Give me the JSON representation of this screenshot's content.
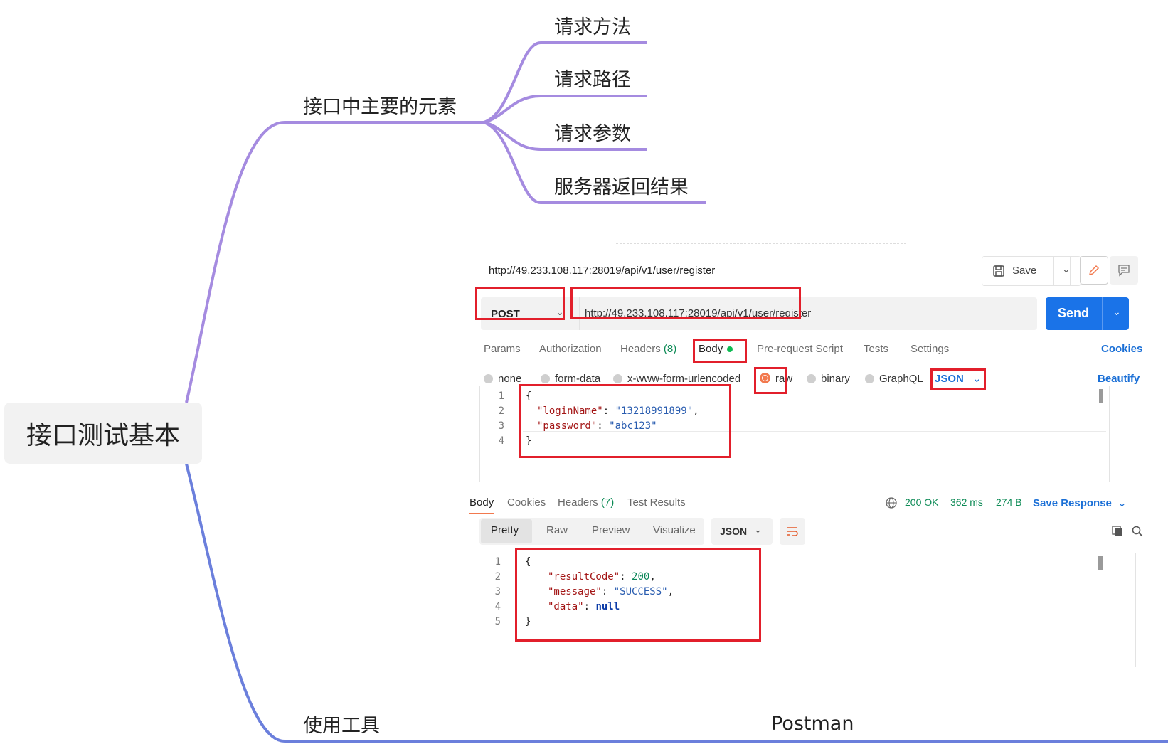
{
  "mindmap": {
    "root": "接口测试基本",
    "branch_elements": "接口中主要的元素",
    "leaves": [
      "请求方法",
      "请求路径",
      "请求参数",
      "服务器返回结果"
    ],
    "branch_tools": "使用工具",
    "tool_name": "Postman",
    "colors": {
      "upper_branch": "#a58be0",
      "lower_branch": "#6b7fdc",
      "highlight_box": "#e21f2b"
    }
  },
  "postman": {
    "request_title": "http://49.233.108.117:28019/api/v1/user/register",
    "save_label": "Save",
    "method": "POST",
    "url": "http://49.233.108.117:28019/api/v1/user/register",
    "send_label": "Send",
    "request_tabs": {
      "params": "Params",
      "authorization": "Authorization",
      "headers": "Headers",
      "headers_count": "(8)",
      "body": "Body",
      "pre_request": "Pre-request Script",
      "tests": "Tests",
      "settings": "Settings",
      "cookies": "Cookies"
    },
    "body_types": {
      "none": "none",
      "form_data": "form-data",
      "urlencoded": "x-www-form-urlencoded",
      "raw": "raw",
      "binary": "binary",
      "graphql": "GraphQL",
      "format": "JSON",
      "beautify": "Beautify"
    },
    "request_body": {
      "line_numbers": [
        "1",
        "2",
        "3",
        "4"
      ],
      "open": "{",
      "close": "}",
      "login_key": "\"loginName\"",
      "login_value": "\"13218991899\"",
      "password_key": "\"password\"",
      "password_value": "\"abc123\""
    },
    "response_tabs": {
      "body": "Body",
      "cookies": "Cookies",
      "headers": "Headers",
      "headers_count": "(7)",
      "test_results": "Test Results"
    },
    "response_status": {
      "code": "200 OK",
      "time": "362 ms",
      "size": "274 B",
      "save_response": "Save Response"
    },
    "view_modes": {
      "pretty": "Pretty",
      "raw": "Raw",
      "preview": "Preview",
      "visualize": "Visualize",
      "format": "JSON"
    },
    "response_body": {
      "line_numbers": [
        "1",
        "2",
        "3",
        "4",
        "5"
      ],
      "open": "{",
      "close": "}",
      "result_key": "\"resultCode\"",
      "result_value": "200",
      "message_key": "\"message\"",
      "message_value": "\"SUCCESS\"",
      "data_key": "\"data\"",
      "data_value": "null"
    }
  }
}
